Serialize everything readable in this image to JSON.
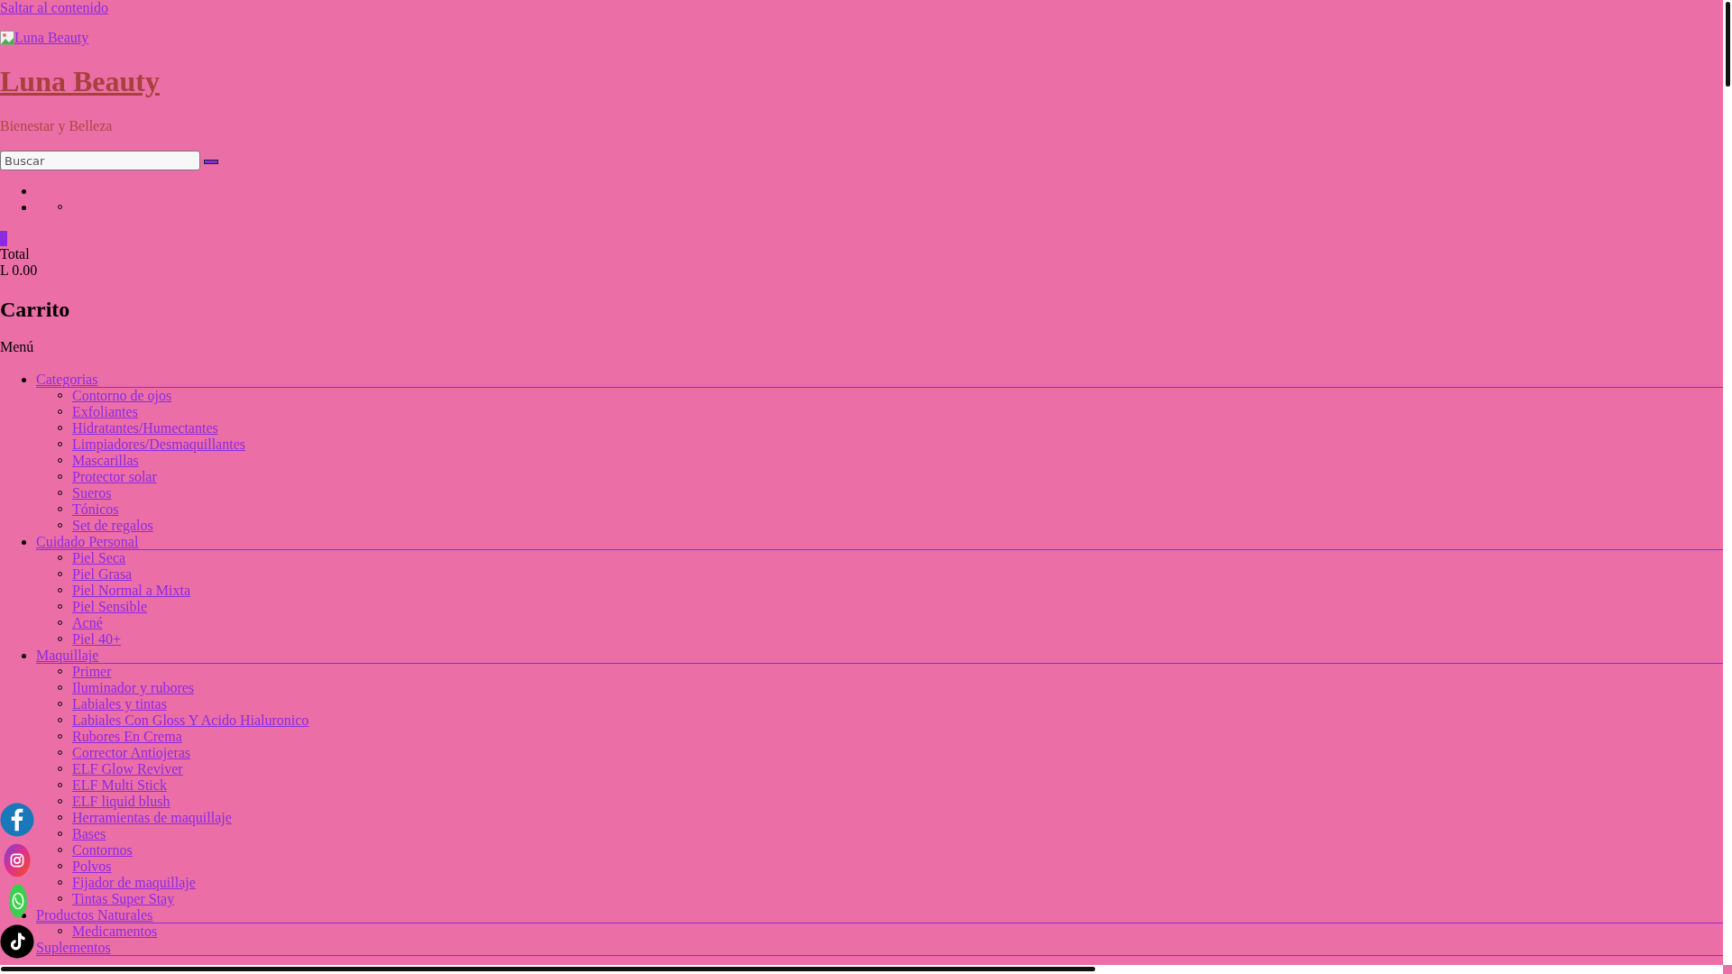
{
  "skip_link": "Saltar al contenido",
  "logo": {
    "alt": "Luna Beauty"
  },
  "site_title": "Luna Beauty",
  "tagline": "Bienestar y Belleza",
  "search": {
    "placeholder": "Buscar"
  },
  "cart": {
    "total_label": "Total",
    "total": "L 0.00",
    "heading": "Carrito"
  },
  "menu": {
    "label": "Menú",
    "items": [
      {
        "label": "Categorias",
        "children": [
          {
            "label": "Contorno de ojos"
          },
          {
            "label": "Exfoliantes"
          },
          {
            "label": "Hidratantes/Humectantes"
          },
          {
            "label": "Limpiadores/Desmaquillantes"
          },
          {
            "label": "Mascarillas"
          },
          {
            "label": "Protector solar"
          },
          {
            "label": "Sueros"
          },
          {
            "label": "Tónicos"
          },
          {
            "label": "Set de regalos"
          }
        ]
      },
      {
        "label": "Cuidado Personal",
        "children": [
          {
            "label": "Piel Seca"
          },
          {
            "label": "Piel Grasa"
          },
          {
            "label": "Piel Normal a Mixta"
          },
          {
            "label": "Piel Sensible"
          },
          {
            "label": "Acné"
          },
          {
            "label": "Piel 40+"
          }
        ]
      },
      {
        "label": "Maquillaje",
        "children": [
          {
            "label": "Primer"
          },
          {
            "label": "Iluminador y rubores"
          },
          {
            "label": "Labiales y tintas"
          },
          {
            "label": "Labiales Con Gloss Y Acido Hialuronico"
          },
          {
            "label": "Rubores En Crema"
          },
          {
            "label": "Corrector Antiojeras"
          },
          {
            "label": "ELF Glow Reviver"
          },
          {
            "label": "ELF Multi Stick"
          },
          {
            "label": "ELF liquid blush"
          },
          {
            "label": "Herramientas de maquillaje"
          },
          {
            "label": "Bases"
          },
          {
            "label": "Contornos"
          },
          {
            "label": "Polvos"
          },
          {
            "label": "Fijador de maquillaje"
          },
          {
            "label": "Tintas Super Stay"
          }
        ]
      },
      {
        "label": "Productos Naturales",
        "children": [
          {
            "label": "Medicamentos"
          }
        ]
      },
      {
        "label": "Suplementos"
      }
    ]
  },
  "social": [
    {
      "kind": "facebook"
    },
    {
      "kind": "instagram"
    },
    {
      "kind": "whatsapp"
    },
    {
      "kind": "tiktok"
    }
  ]
}
